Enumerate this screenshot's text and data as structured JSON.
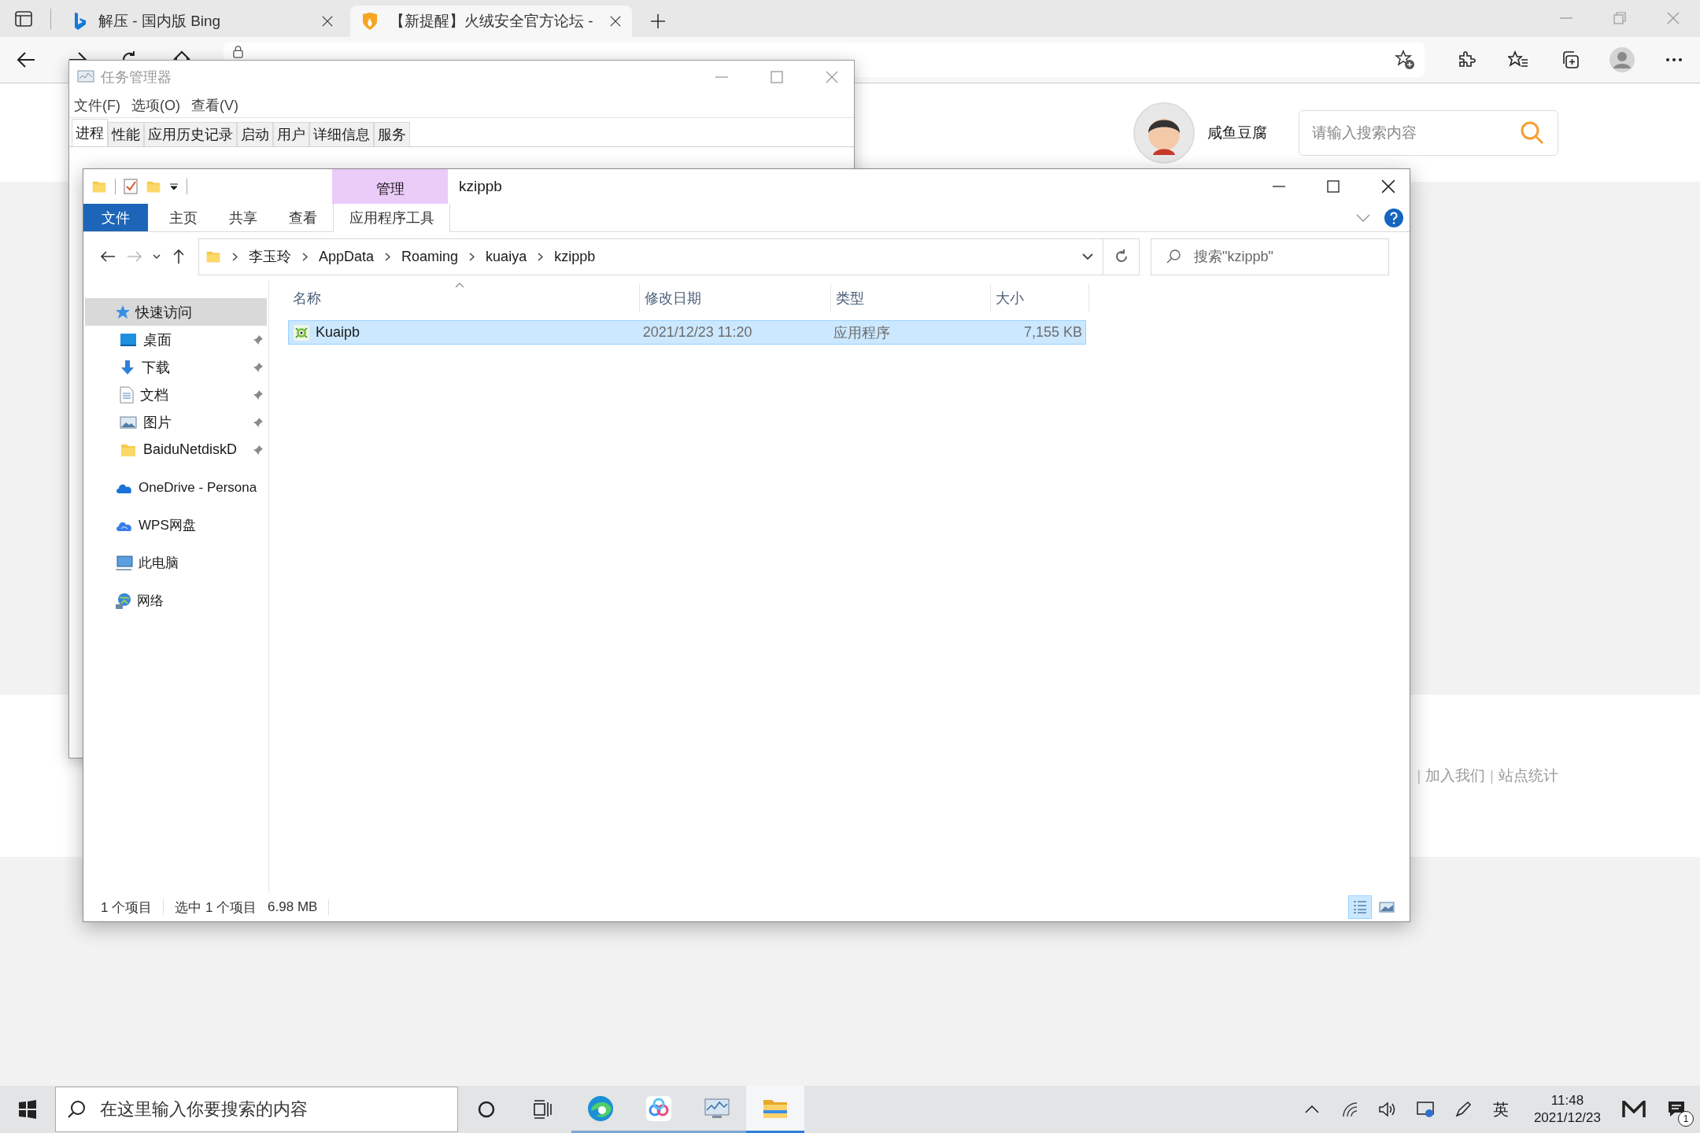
{
  "browser": {
    "tabs": [
      {
        "title": "解压 - 国内版 Bing",
        "kind": "letter-b",
        "selected": false
      },
      {
        "title": "【新提醒】火绒安全官方论坛 -",
        "kind": "flame",
        "selected": true
      }
    ]
  },
  "page": {
    "user_name": "咸鱼豆腐",
    "search": {
      "placeholder": "请输入搜索内容"
    },
    "footer_items": [
      {
        "kind": "separator",
        "text": "|"
      },
      {
        "kind": "link",
        "text": "加入我们"
      },
      {
        "kind": "separator",
        "text": "|"
      },
      {
        "kind": "link",
        "text": "站点统计"
      }
    ]
  },
  "task_manager": {
    "title": "任务管理器",
    "menu": [
      "文件(F)",
      "选项(O)",
      "查看(V)"
    ],
    "tabs": [
      {
        "label": "进程",
        "selected": true
      },
      {
        "label": "性能",
        "selected": false
      },
      {
        "label": "应用历史记录",
        "selected": false
      },
      {
        "label": "启动",
        "selected": false
      },
      {
        "label": "用户",
        "selected": false
      },
      {
        "label": "详细信息",
        "selected": false
      },
      {
        "label": "服务",
        "selected": false
      }
    ]
  },
  "explorer": {
    "title": "kzippb",
    "context_group": "管理",
    "ribbon_tabs": [
      {
        "label": "文件",
        "kind": "file"
      },
      {
        "label": "主页",
        "kind": "tab"
      },
      {
        "label": "共享",
        "kind": "tab"
      },
      {
        "label": "查看",
        "kind": "tab"
      },
      {
        "label": "应用程序工具",
        "kind": "context"
      }
    ],
    "breadcrumb": [
      "李玉玲",
      "AppData",
      "Roaming",
      "kuaiya",
      "kzippb"
    ],
    "search": {
      "placeholder": "搜索\"kzippb\""
    },
    "nav": [
      {
        "label": "快速访问",
        "kind": "star",
        "selected": true,
        "children": [
          {
            "label": "桌面",
            "kind": "desktop",
            "selected": false
          },
          {
            "label": "下载",
            "kind": "download",
            "selected": false
          },
          {
            "label": "文档",
            "kind": "document",
            "selected": false
          },
          {
            "label": "图片",
            "kind": "pictures",
            "selected": false
          },
          {
            "label": "BaiduNetdiskD",
            "kind": "folder",
            "selected": false
          }
        ]
      },
      {
        "label": "OneDrive - Persona",
        "kind": "onedrive",
        "selected": false
      },
      {
        "label": "WPS网盘",
        "kind": "wps",
        "selected": false
      },
      {
        "label": "此电脑",
        "kind": "pc",
        "selected": false
      },
      {
        "label": "网络",
        "kind": "network",
        "selected": false
      }
    ],
    "columns": [
      "名称",
      "修改日期",
      "类型",
      "大小"
    ],
    "rows": [
      {
        "name": "Kuaipb",
        "modified": "2021/12/23 11:20",
        "type": "应用程序",
        "size": "7,155 KB",
        "selected": true
      }
    ],
    "status": {
      "count": "1 个项目",
      "selection": "选中 1 个项目",
      "selection_size": "6.98 MB"
    },
    "views": [
      {
        "kind": "details",
        "selected": true
      },
      {
        "kind": "large_icons",
        "selected": false
      }
    ]
  },
  "taskbar": {
    "search": {
      "placeholder": "在这里输入你要搜索的内容"
    },
    "apps": [
      {
        "kind": "browser",
        "selected": false
      },
      {
        "kind": "cloud",
        "selected": false
      },
      {
        "kind": "monitor",
        "selected": false
      },
      {
        "kind": "folder",
        "selected": true
      }
    ],
    "ime": "英",
    "time": "11:48",
    "date": "2021/12/23",
    "notification_count": "1"
  }
}
